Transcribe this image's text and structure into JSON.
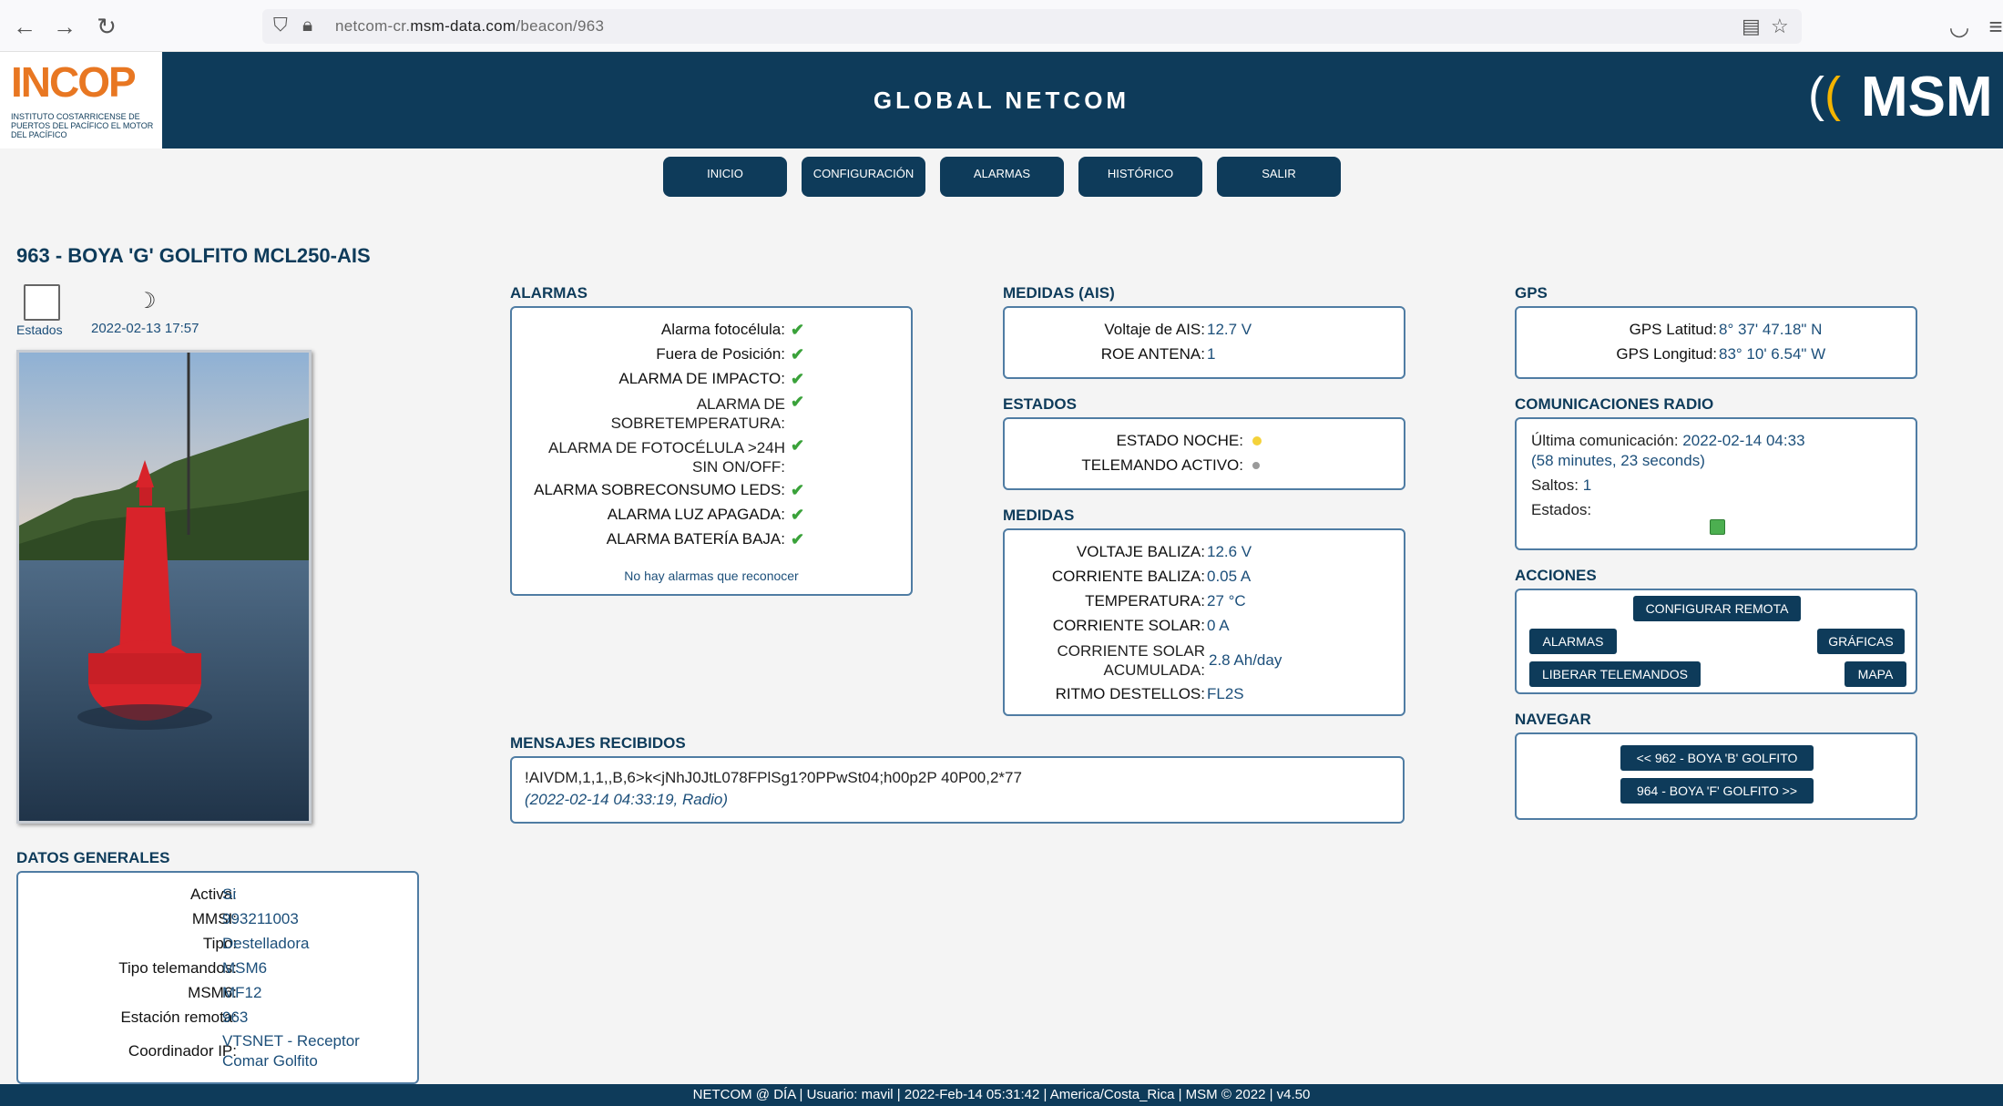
{
  "browser": {
    "url_prefix": "netcom-cr.",
    "url_host": "msm-data.com",
    "url_path": "/beacon/963"
  },
  "header": {
    "title": "GLOBAL NETCOM",
    "incop_word": "INCOP",
    "incop_sub": "INSTITUTO COSTARRICENSE DE PUERTOS DEL PACÍFICO EL MOTOR DEL PACÍFICO",
    "msm_word": "MSM"
  },
  "menu": [
    "INICIO",
    "CONFIGURACIÓN",
    "ALARMAS",
    "HISTÓRICO",
    "SALIR"
  ],
  "page_title": "963 - BOYA 'G' GOLFITO MCL250-AIS",
  "status": {
    "estados_label": "Estados",
    "date": "2022-02-13 17:57"
  },
  "datos_generales": {
    "title": "DATOS GENERALES",
    "rows": [
      {
        "label": "Activa:",
        "value": "Si"
      },
      {
        "label": "MMSI:",
        "value": "993211003"
      },
      {
        "label": "Tipo:",
        "value": "Destelladora"
      },
      {
        "label": "Tipo telemandos:",
        "value": "MSM6"
      },
      {
        "label": "MSM6:",
        "value": "MF12"
      },
      {
        "label": "Estación remota:",
        "value": "963"
      },
      {
        "label": "Coordinador IP:",
        "value": "VTSNET - Receptor",
        "value2": "Comar Golfito"
      }
    ]
  },
  "alarmas": {
    "title": "ALARMAS",
    "rows": [
      {
        "label": "Alarma fotocélula:"
      },
      {
        "label": "Fuera de Posición:"
      },
      {
        "label": "ALARMA DE IMPACTO:"
      },
      {
        "label": "ALARMA DE",
        "label2": "SOBRETEMPERATURA:"
      },
      {
        "label": "ALARMA DE FOTOCÉLULA >24H",
        "label2": "SIN ON/OFF:"
      },
      {
        "label": "ALARMA SOBRECONSUMO LEDS:"
      },
      {
        "label": "ALARMA LUZ APAGADA:"
      },
      {
        "label": "ALARMA BATERÍA BAJA:"
      }
    ],
    "footer": "No hay alarmas que reconocer",
    "status_color": "#3aa23a"
  },
  "medidas_ais": {
    "title": "MEDIDAS (AIS)",
    "rows": [
      {
        "label": "Voltaje de AIS:",
        "value": "12.7 V"
      },
      {
        "label": "ROE ANTENA:",
        "value": "1"
      }
    ]
  },
  "estados": {
    "title": "ESTADOS",
    "rows": [
      {
        "label": "ESTADO NOCHE:",
        "color": "#f4d23a"
      },
      {
        "label": "TELEMANDO ACTIVO:",
        "color": "#9a9a9a"
      }
    ]
  },
  "medidas": {
    "title": "MEDIDAS",
    "rows": [
      {
        "label": "VOLTAJE BALIZA:",
        "value": "12.6 V"
      },
      {
        "label": "CORRIENTE BALIZA:",
        "value": "0.05 A"
      },
      {
        "label": "TEMPERATURA:",
        "value": "27 °C"
      },
      {
        "label": "CORRIENTE SOLAR:",
        "value": "0 A"
      },
      {
        "label": "CORRIENTE SOLAR",
        "label2": "ACUMULADA:",
        "value": "2.8 Ah/day"
      },
      {
        "label": "RITMO DESTELLOS:",
        "value": "FL2S"
      }
    ]
  },
  "gps": {
    "title": "GPS",
    "rows": [
      {
        "label": "GPS Latitud:",
        "value": "8° 37' 47.18\" N"
      },
      {
        "label": "GPS Longitud:",
        "value": "83° 10' 6.54\" W"
      }
    ]
  },
  "comunicaciones": {
    "title": "COMUNICACIONES RADIO",
    "ultima_label": "Última comunicación:",
    "ultima_value": "2022-02-14 04:33",
    "elapsed": "(58 minutes, 23 seconds)",
    "saltos_label": "Saltos:",
    "saltos_value": "1",
    "estados_label": "Estados:",
    "estados_color": "#4caf50"
  },
  "acciones": {
    "title": "ACCIONES",
    "configurar": "CONFIGURAR REMOTA",
    "alarmas": "ALARMAS",
    "graficas": "GRÁFICAS",
    "liberar": "LIBERAR TELEMANDOS",
    "mapa": "MAPA"
  },
  "navegar": {
    "title": "NAVEGAR",
    "prev": "<< 962 - BOYA 'B' GOLFITO",
    "next": "964 - BOYA 'F' GOLFITO >>"
  },
  "mensajes": {
    "title": "MENSAJES RECIBIDOS",
    "message": "!AIVDM,1,1,,B,6>k<jNhJ0JtL078FPlSg1?0PPwSt04;h00p2P 40P00,2*77",
    "meta": "(2022-02-14 04:33:19, Radio)"
  },
  "footer": "NETCOM @ DÍA | Usuario: mavil | 2022-Feb-14 05:31:42 | America/Costa_Rica | MSM © 2022 | v4.50"
}
